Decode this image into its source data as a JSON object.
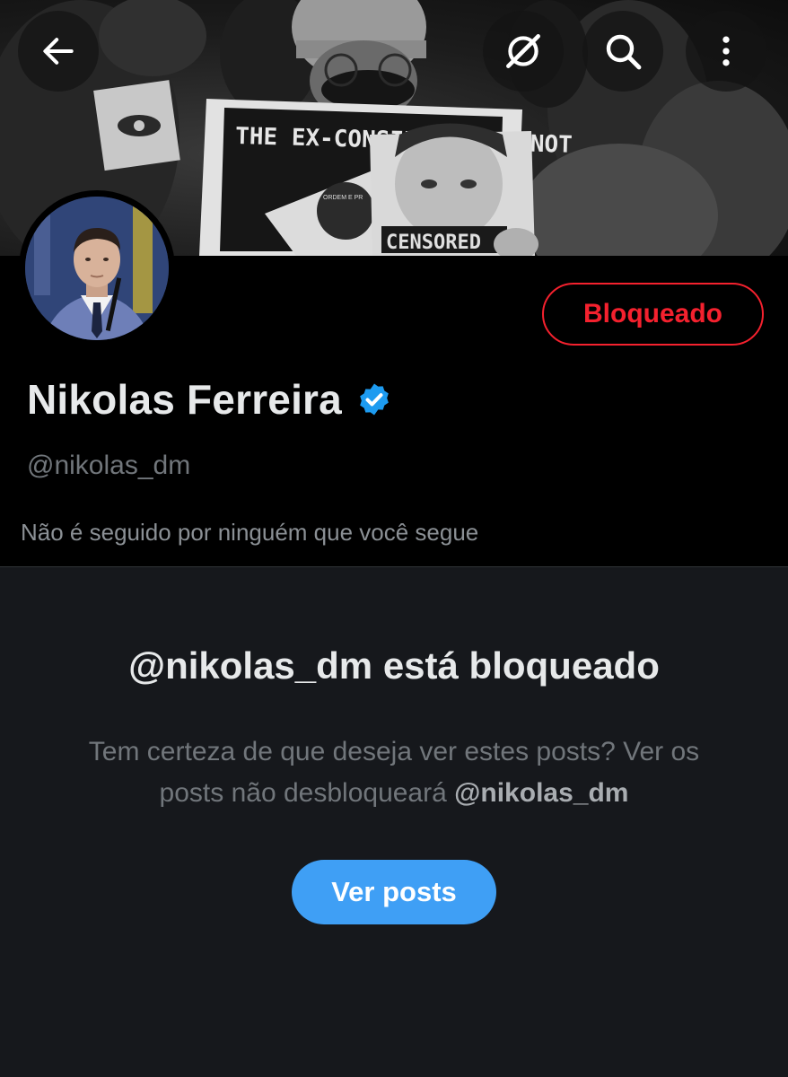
{
  "header": {
    "back_icon": "arrow-left-icon",
    "grok_icon": "grok-icon",
    "search_icon": "search-icon",
    "more_icon": "more-vertical-icon"
  },
  "banner": {
    "sign_top_text": "THE EX-CONSIDERED CANNOT",
    "sign_bottom_text": "CENSORED",
    "flag_band_text": "ORDEM E PR"
  },
  "profile": {
    "display_name": "Nikolas Ferreira",
    "handle": "@nikolas_dm",
    "block_button_label": "Bloqueado",
    "followed_by_text": "Não é seguido por ninguém que você segue",
    "verified_icon": "verified-badge-icon"
  },
  "blocked_notice": {
    "title": "@nikolas_dm está bloqueado",
    "body_prefix": "Tem certeza de que deseja ver estes posts? Ver os posts não desbloqueará ",
    "body_handle": "@nikolas_dm",
    "view_button_label": "Ver posts"
  },
  "colors": {
    "background": "#16181c",
    "header_background": "#000000",
    "block_red": "#f4212e",
    "primary_blue": "#3f9ff5",
    "verified_blue": "#1d9bf0",
    "secondary_text": "#71767b"
  }
}
